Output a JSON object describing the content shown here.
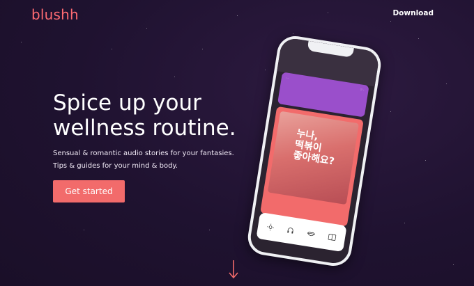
{
  "header": {
    "logo": "blushh",
    "download_label": "Download"
  },
  "hero": {
    "headline": "Spice up your wellness routine.",
    "subline_1": "Sensual & romantic audio stories for your fantasies.",
    "subline_2": "Tips & guides for your mind & body.",
    "cta_label": "Get started"
  },
  "phone": {
    "art_text": "누나,\n떡볶이\n좋아해요?",
    "tabs": [
      {
        "icon": "sun-icon"
      },
      {
        "icon": "headphones-icon"
      },
      {
        "icon": "lips-icon"
      },
      {
        "icon": "book-icon"
      }
    ]
  },
  "colors": {
    "accent": "#f26b6b",
    "logo": "#ff6b72",
    "background": "#1f1230",
    "card_purple": "#9a4fcb"
  },
  "scroll_indicator": {
    "icon": "arrow-down-icon"
  }
}
